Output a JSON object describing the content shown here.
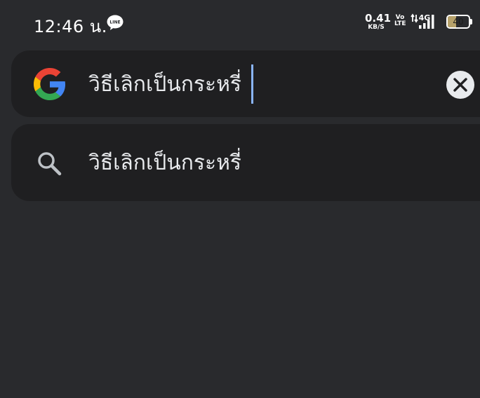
{
  "status_bar": {
    "time": "12:46 น.",
    "line_app": {
      "label": "LINE",
      "icon": "line-app-icon"
    },
    "net_speed_value": "0.41",
    "net_speed_unit": "KB/S",
    "volte_top": "Vo",
    "volte_bottom": "LTE",
    "network_type": "4G",
    "battery_level": "40",
    "battery_fraction": 0.4,
    "battery_color": "#b6a16a"
  },
  "search": {
    "query": "วิธีเลิกเป็นกระหรี่",
    "logo_icon": "google-g-icon",
    "clear_icon": "close-icon",
    "caret_color": "#8ab4f8"
  },
  "suggestions": [
    {
      "icon": "search-icon",
      "text": "วิธีเลิกเป็นกระหรี่"
    }
  ]
}
